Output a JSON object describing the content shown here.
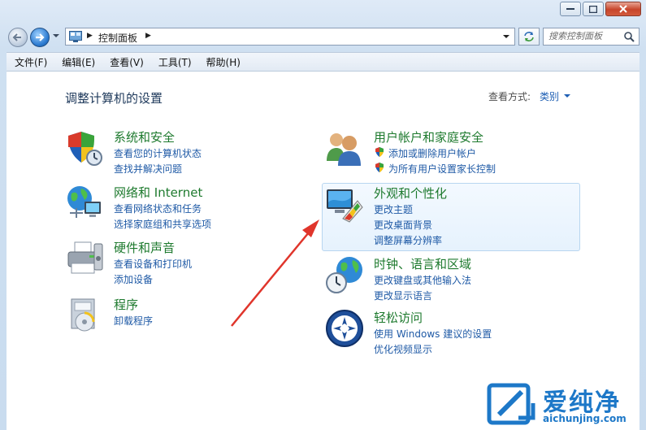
{
  "address": {
    "breadcrumb": "控制面板",
    "search_placeholder": "搜索控制面板"
  },
  "menu": [
    "文件(F)",
    "编辑(E)",
    "查看(V)",
    "工具(T)",
    "帮助(H)"
  ],
  "page": {
    "title": "调整计算机的设置",
    "view_by_label": "查看方式:",
    "view_by_value": "类别"
  },
  "left_categories": [
    {
      "title": "系统和安全",
      "links": [
        "查看您的计算机状态",
        "查找并解决问题"
      ],
      "icon": "shield-icon"
    },
    {
      "title": "网络和 Internet",
      "links": [
        "查看网络状态和任务",
        "选择家庭组和共享选项"
      ],
      "icon": "network-globe-icon"
    },
    {
      "title": "硬件和声音",
      "links": [
        "查看设备和打印机",
        "添加设备"
      ],
      "icon": "printer-icon"
    },
    {
      "title": "程序",
      "links": [
        "卸载程序"
      ],
      "icon": "programs-icon"
    }
  ],
  "right_categories": [
    {
      "title": "用户帐户和家庭安全",
      "links": [
        "添加或删除用户帐户",
        "为所有用户设置家长控制"
      ],
      "icon": "users-icon"
    },
    {
      "title": "外观和个性化",
      "links": [
        "更改主题",
        "更改桌面背景",
        "调整屏幕分辨率"
      ],
      "icon": "monitor-palette-icon"
    },
    {
      "title": "时钟、语言和区域",
      "links": [
        "更改键盘或其他输入法",
        "更改显示语言"
      ],
      "icon": "clock-globe-icon"
    },
    {
      "title": "轻松访问",
      "links": [
        "使用 Windows 建议的设置",
        "优化视频显示"
      ],
      "icon": "ease-of-access-icon"
    }
  ],
  "watermark": {
    "text": "爱纯净",
    "url": "aichunjing.com"
  },
  "colors": {
    "category_title": "#1e7a2e",
    "link": "#1f5aa6",
    "annotation_arrow": "#e0352b"
  }
}
